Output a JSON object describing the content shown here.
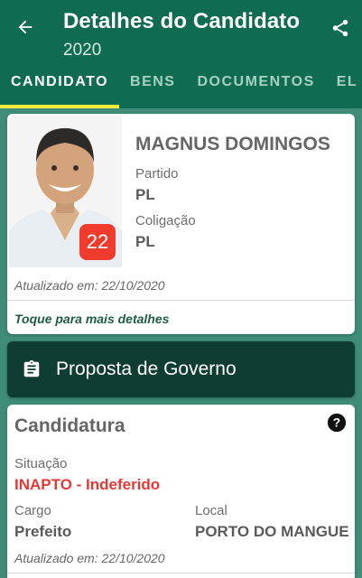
{
  "header": {
    "title": "Detalhes do Candidato",
    "year": "2020",
    "back_icon": "arrow-back-icon",
    "share_icon": "share-icon"
  },
  "tabs": [
    {
      "label": "CANDIDATO",
      "active": true
    },
    {
      "label": "BENS",
      "active": false
    },
    {
      "label": "DOCUMENTOS",
      "active": false
    },
    {
      "label": "EL",
      "active": false
    }
  ],
  "candidate": {
    "name": "MAGNUS DOMINGOS",
    "number": "22",
    "party_label": "Partido",
    "party": "PL",
    "coalition_label": "Coligação",
    "coalition": "PL",
    "updated": "Atualizado em: 22/10/2020",
    "more_details": "Toque para mais detalhes"
  },
  "proposal": {
    "label": "Proposta de Governo",
    "icon": "clipboard-icon"
  },
  "candidacy": {
    "title": "Candidatura",
    "help_icon": "help-icon",
    "status_label": "Situação",
    "status": "INAPTO - Indeferido",
    "office_label": "Cargo",
    "office": "Prefeito",
    "location_label": "Local",
    "location": "PORTO DO MANGUE",
    "updated": "Atualizado em: 22/10/2020"
  },
  "colors": {
    "appbar": "#0f6b52",
    "background": "#3f8c79",
    "tab_indicator": "#ffeb3b",
    "badge": "#ef3b2d",
    "status": "#e53935",
    "proposal_button": "#0f3d33"
  }
}
